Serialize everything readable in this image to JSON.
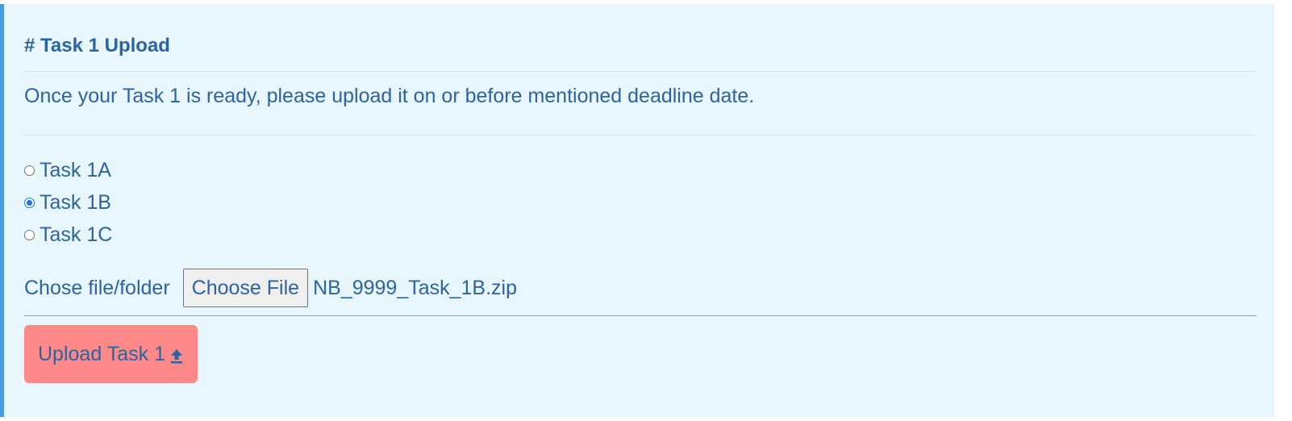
{
  "section": {
    "title": "# Task 1 Upload",
    "description": "Once your Task 1 is ready, please upload it on or before mentioned deadline date."
  },
  "task_options": [
    {
      "label": "Task 1A",
      "selected": false
    },
    {
      "label": "Task 1B",
      "selected": true
    },
    {
      "label": "Task 1C",
      "selected": false
    }
  ],
  "file": {
    "label": "Chose file/folder",
    "button_label": "Choose File",
    "selected_file": "NB_9999_Task_1B.zip"
  },
  "upload_button": {
    "label": "Upload Task 1",
    "icon": "upload-arrow-icon"
  },
  "colors": {
    "panel_background": "#e8f6fd",
    "accent_border": "#4a9be0",
    "text": "#2c64a3",
    "upload_button": "#ff8888"
  }
}
